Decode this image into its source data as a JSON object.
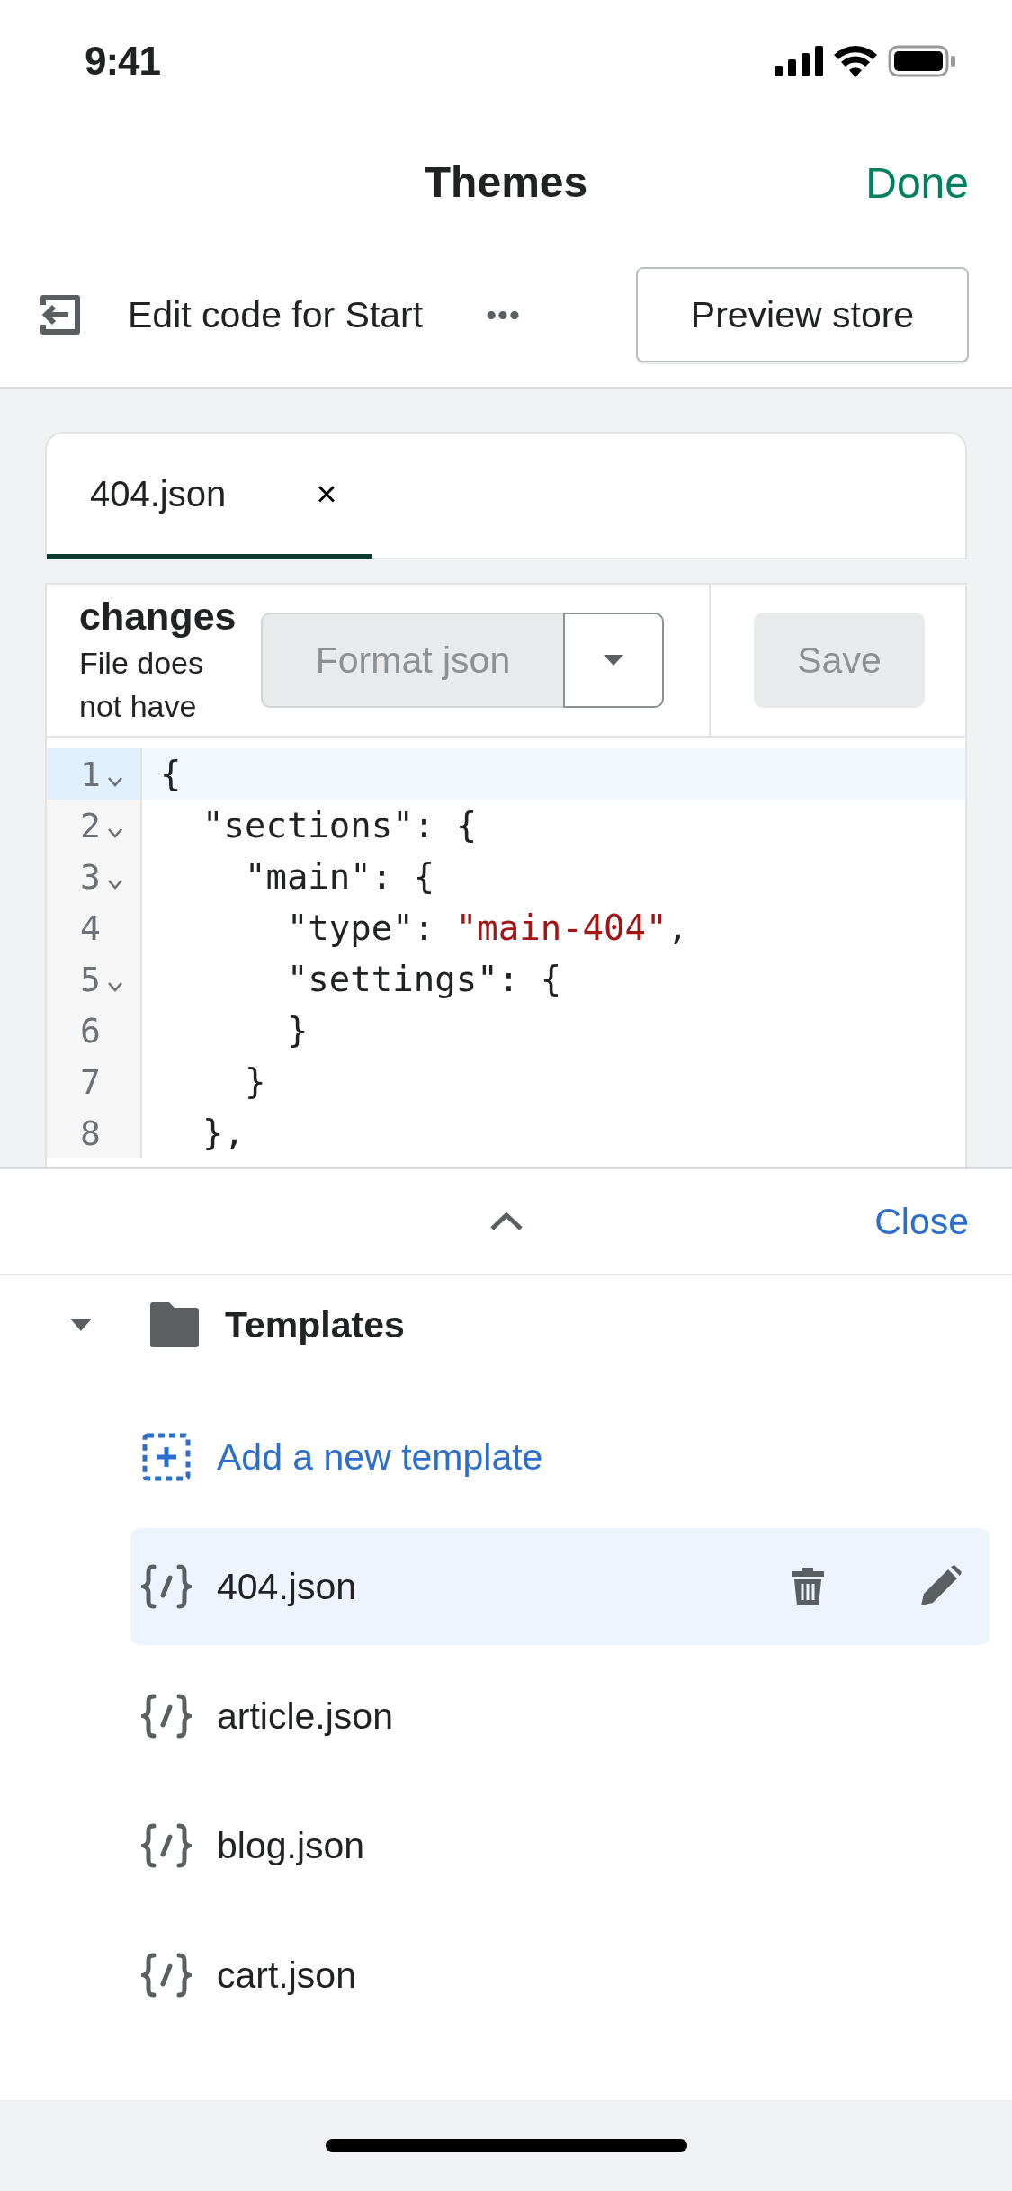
{
  "status_bar": {
    "time": "9:41"
  },
  "nav": {
    "title": "Themes",
    "done": "Done"
  },
  "toolbar": {
    "title": "Edit code for Start",
    "more": "•••",
    "preview": "Preview store"
  },
  "tabs": [
    {
      "label": "404.json",
      "close": "×",
      "selected": true
    }
  ],
  "actions": {
    "heading": "changes",
    "note": "File does not have",
    "format": "Format json",
    "format_disabled": true,
    "save": "Save",
    "save_disabled": true
  },
  "code": {
    "lines": [
      {
        "number": "1",
        "foldable": true,
        "active": true,
        "tokens": [
          {
            "kind": "plain",
            "text": "{"
          }
        ]
      },
      {
        "number": "2",
        "foldable": true,
        "active": false,
        "tokens": [
          {
            "kind": "plain",
            "text": "  \"sections\": {"
          }
        ]
      },
      {
        "number": "3",
        "foldable": true,
        "active": false,
        "tokens": [
          {
            "kind": "plain",
            "text": "    \"main\": {"
          }
        ]
      },
      {
        "number": "4",
        "foldable": false,
        "active": false,
        "tokens": [
          {
            "kind": "plain",
            "text": "      \"type\": "
          },
          {
            "kind": "string",
            "text": "\"main-404\""
          },
          {
            "kind": "plain",
            "text": ","
          }
        ]
      },
      {
        "number": "5",
        "foldable": true,
        "active": false,
        "tokens": [
          {
            "kind": "plain",
            "text": "      \"settings\": {"
          }
        ]
      },
      {
        "number": "6",
        "foldable": false,
        "active": false,
        "tokens": [
          {
            "kind": "plain",
            "text": "      }"
          }
        ]
      },
      {
        "number": "7",
        "foldable": false,
        "active": false,
        "tokens": [
          {
            "kind": "plain",
            "text": "    }"
          }
        ]
      },
      {
        "number": "8",
        "foldable": false,
        "active": false,
        "tokens": [
          {
            "kind": "plain",
            "text": "  },"
          }
        ]
      }
    ]
  },
  "sheet": {
    "close": "Close"
  },
  "tree": {
    "label": "Templates",
    "expanded": true,
    "children": [
      {
        "kind": "add",
        "label": "Add a new template"
      },
      {
        "kind": "file",
        "label": "404.json",
        "selected": true
      },
      {
        "kind": "file",
        "label": "article.json",
        "selected": false
      },
      {
        "kind": "file",
        "label": "blog.json",
        "selected": false
      },
      {
        "kind": "file",
        "label": "cart.json",
        "selected": false
      }
    ]
  }
}
